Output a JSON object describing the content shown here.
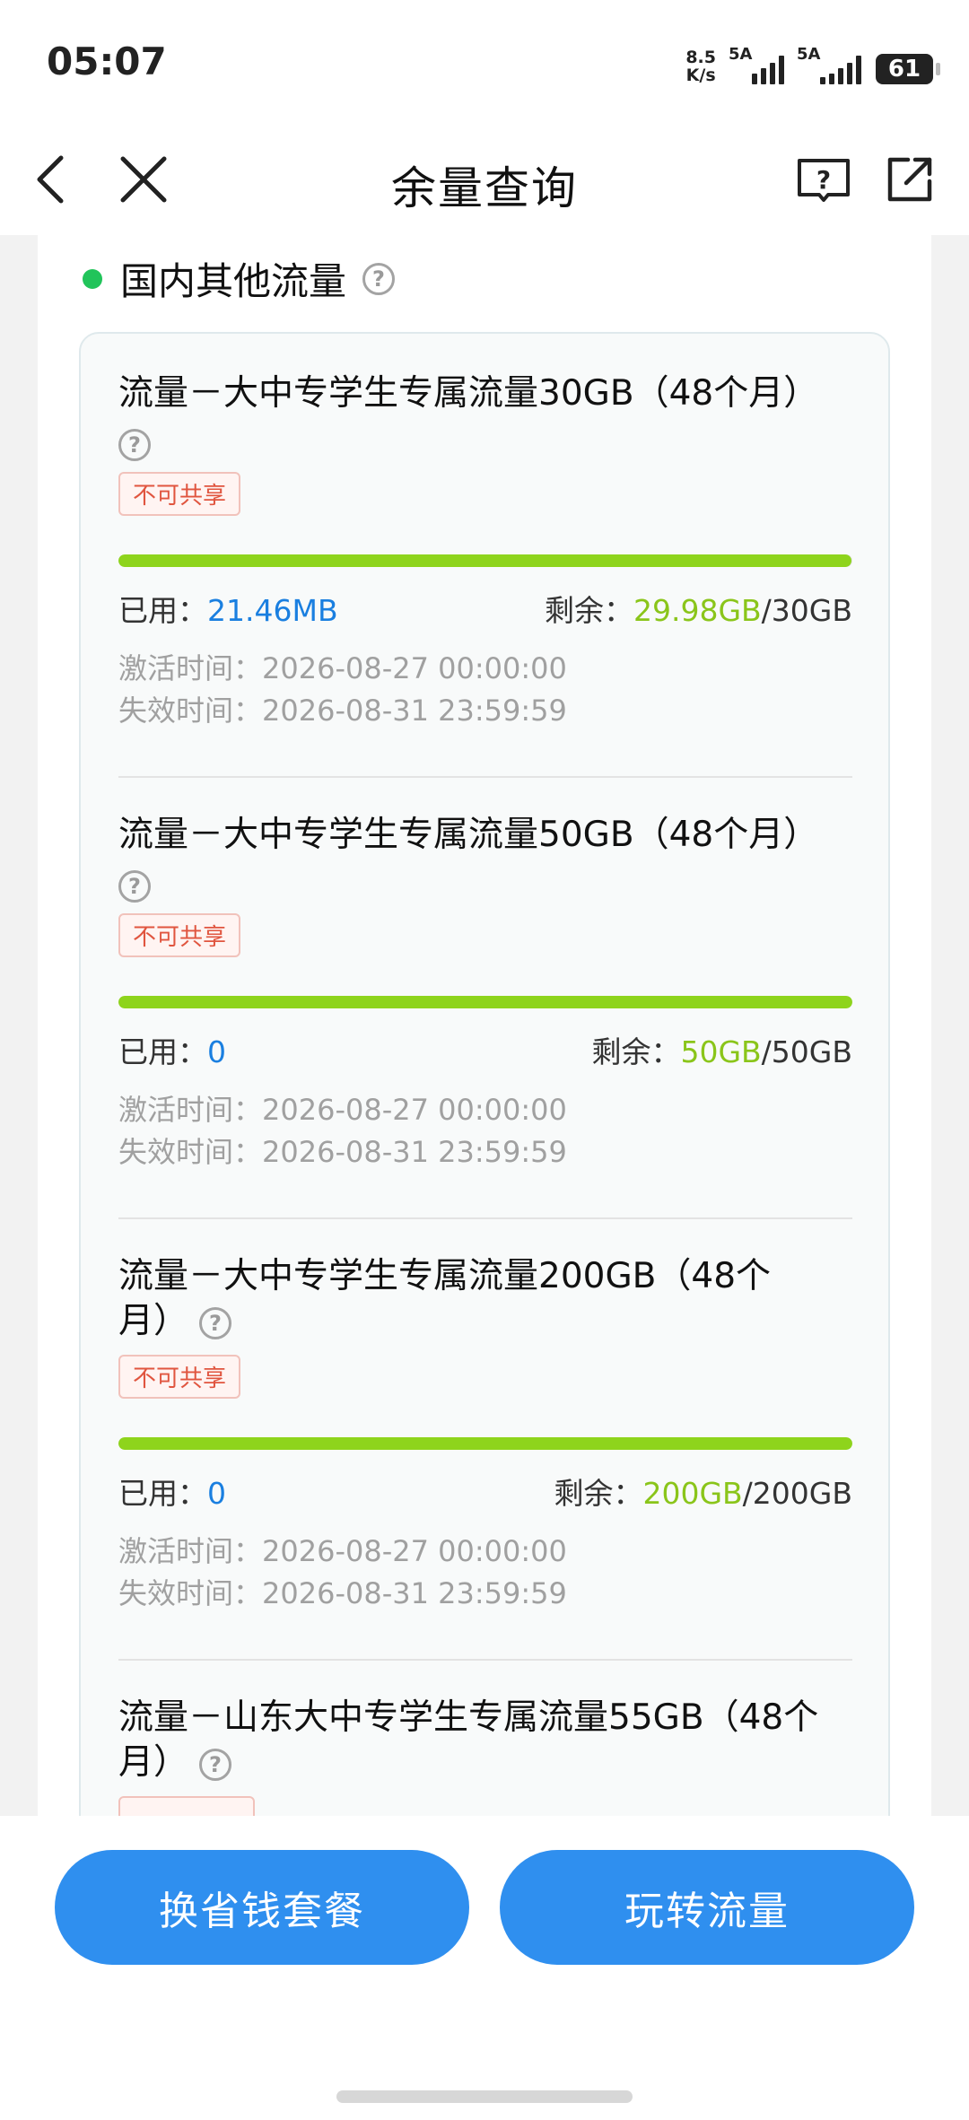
{
  "status_bar": {
    "time": "05:07",
    "net_speed_value": "8.5",
    "net_speed_unit": "K/s",
    "signal1_label": "5A",
    "signal2_label": "5A",
    "battery_level": "61"
  },
  "nav": {
    "title": "余量查询",
    "back_icon": "chevron-left-icon",
    "close_icon": "close-icon",
    "help_icon": "help-book-icon",
    "share_icon": "share-external-icon"
  },
  "section": {
    "title": "国内其他流量",
    "dot_color": "#21c45a"
  },
  "packages": [
    {
      "title": "流量－大中专学生专属流量30GB（48个月）",
      "tag": "不可共享",
      "used_label": "已用：",
      "used": "21.46MB",
      "remain_label": "剩余：",
      "remain": "29.98GB",
      "total": "/30GB",
      "used_fraction": 0.0007,
      "activate": "激活时间：2026-08-27 00:00:00",
      "expire": "失效时间：2026-08-31 23:59:59"
    },
    {
      "title": "流量－大中专学生专属流量50GB（48个月）",
      "tag": "不可共享",
      "used_label": "已用：",
      "used": "0",
      "remain_label": "剩余：",
      "remain": "50GB",
      "total": "/50GB",
      "used_fraction": 0,
      "activate": "激活时间：2026-08-27 00:00:00",
      "expire": "失效时间：2026-08-31 23:59:59"
    },
    {
      "title": "流量－大中专学生专属流量200GB（48个月）",
      "tag": "不可共享",
      "used_label": "已用：",
      "used": "0",
      "remain_label": "剩余：",
      "remain": "200GB",
      "total": "/200GB",
      "used_fraction": 0,
      "activate": "激活时间：2026-08-27 00:00:00",
      "expire": "失效时间：2026-08-31 23:59:59"
    },
    {
      "title": "流量－山东大中专学生专属流量55GB（48个月）"
    }
  ],
  "actions": {
    "left_button": "换省钱套餐",
    "right_button": "玩转流量",
    "button_color": "#2f8fef"
  }
}
